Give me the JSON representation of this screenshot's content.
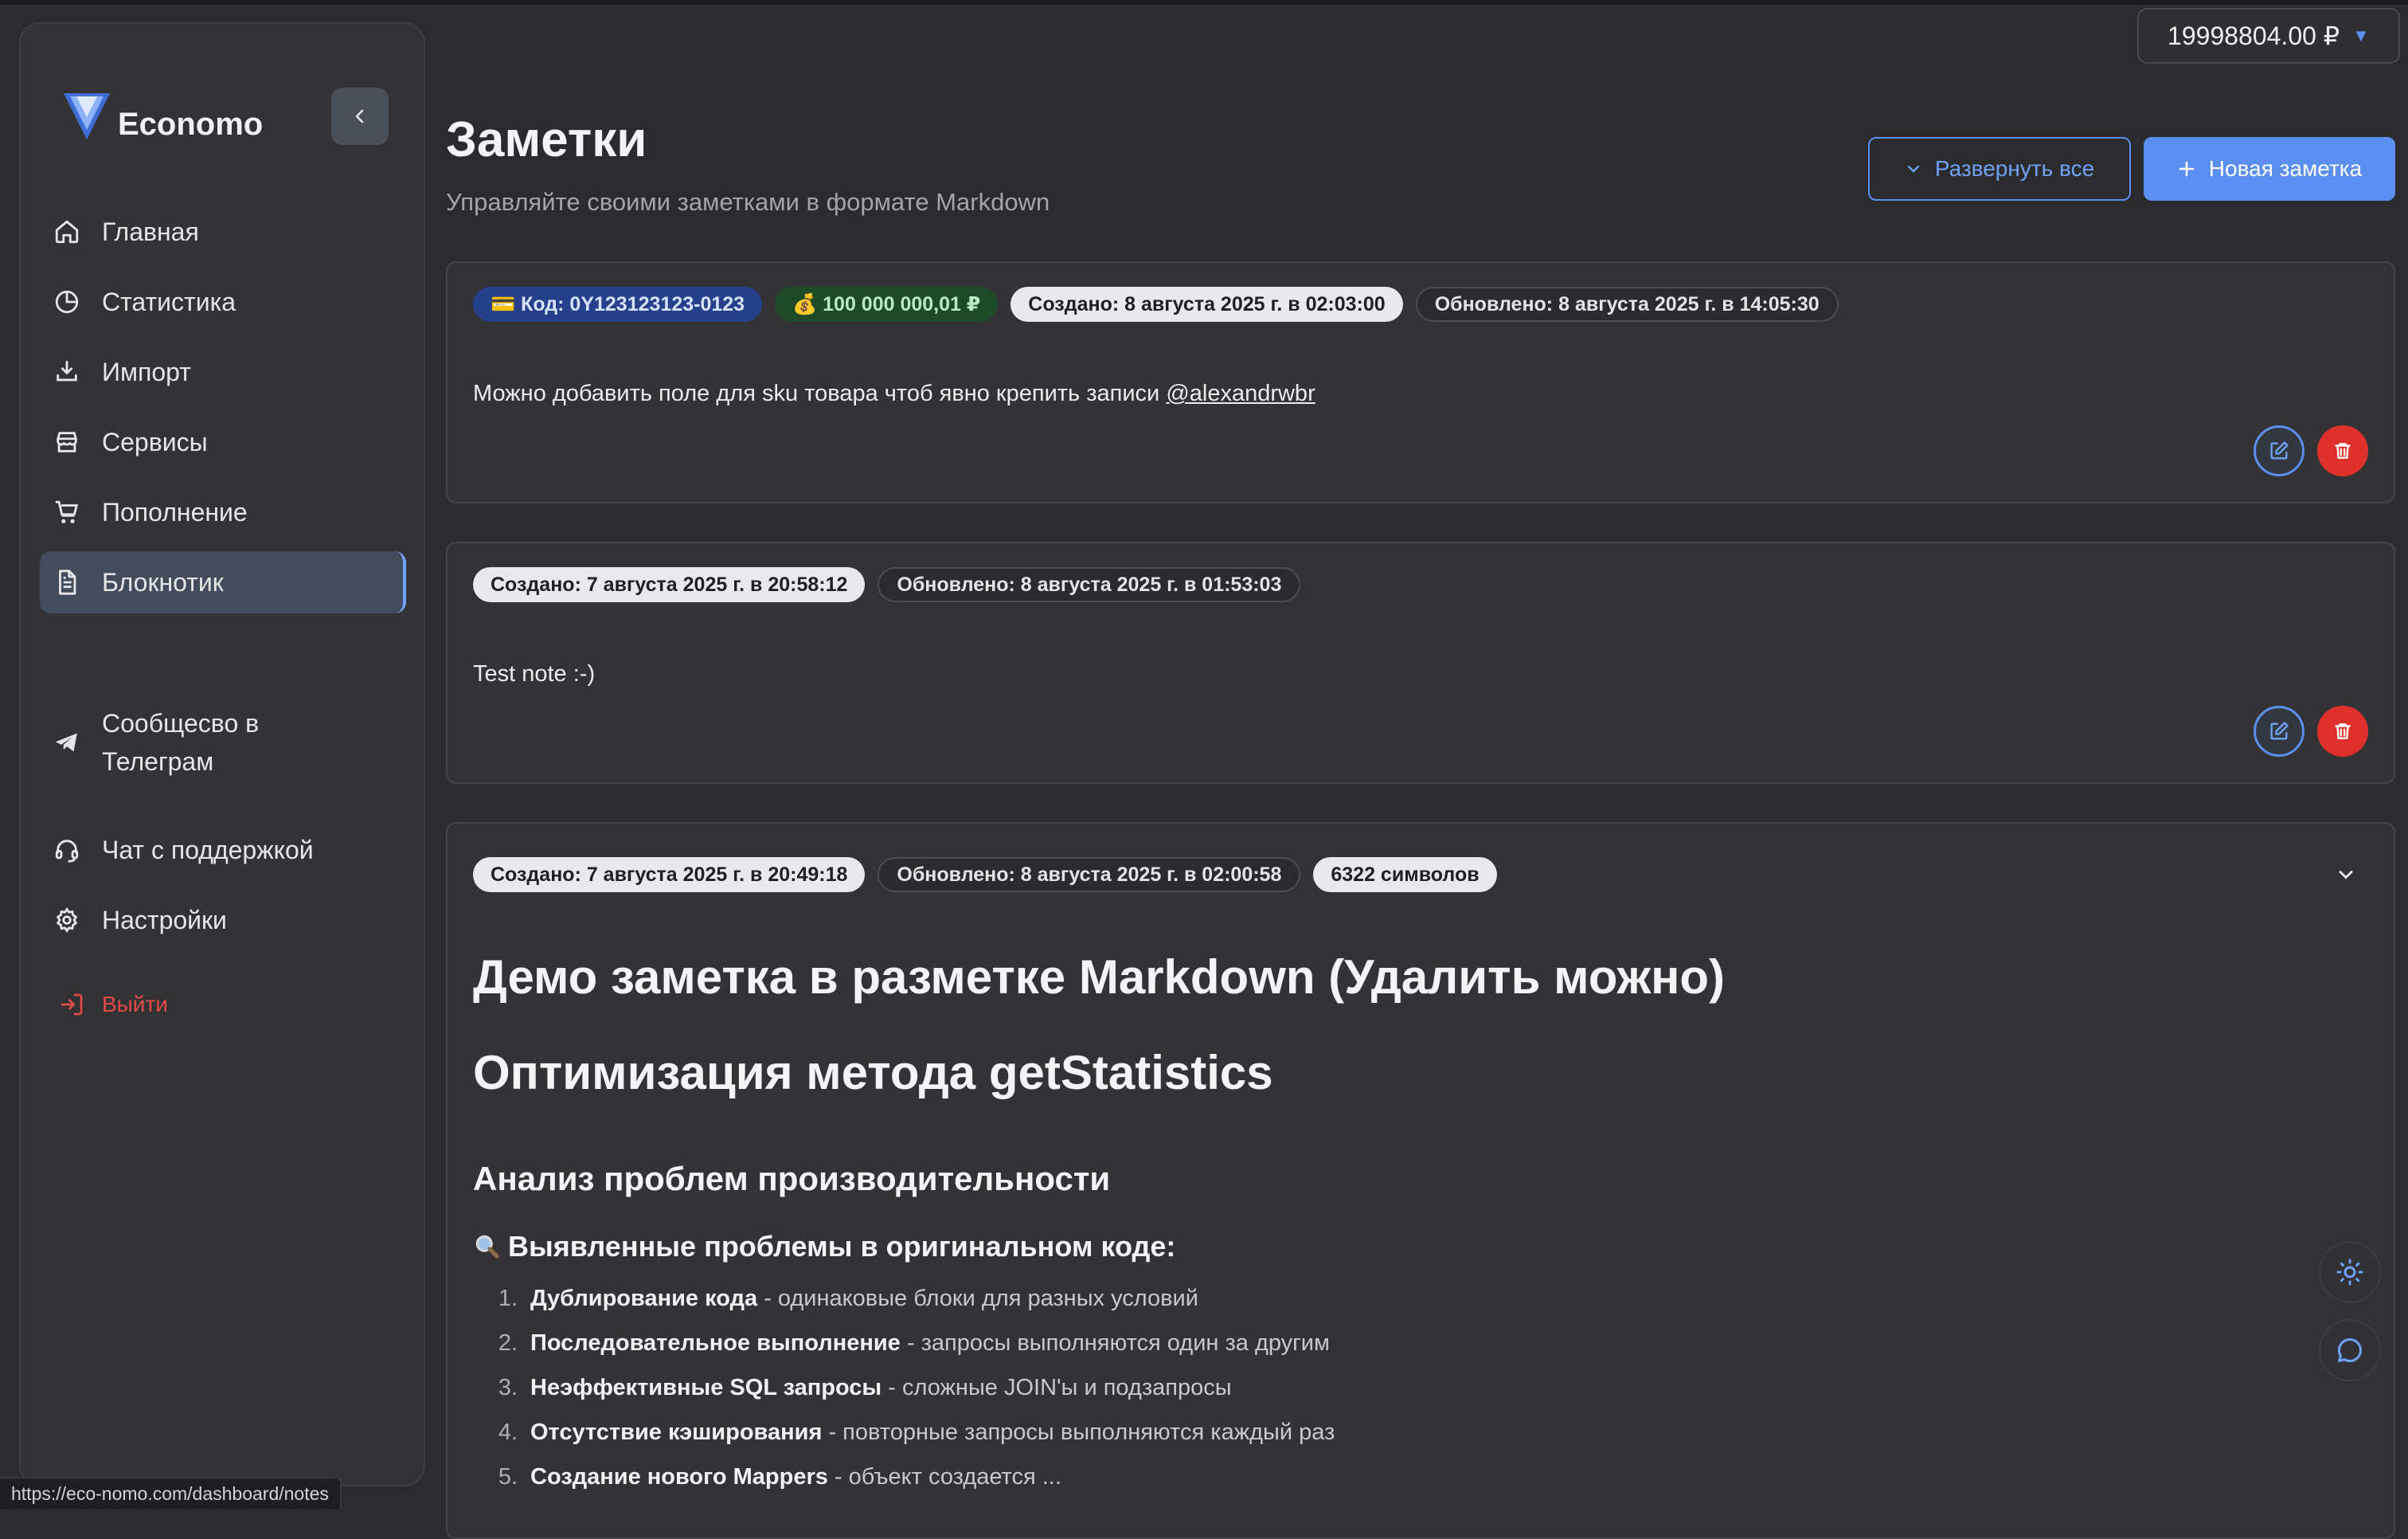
{
  "app": {
    "name": "Economo",
    "balance": "19998804.00 ₽"
  },
  "sidebar": {
    "items": [
      {
        "label": "Главная",
        "icon": "home-icon"
      },
      {
        "label": "Статистика",
        "icon": "chart-pie-icon"
      },
      {
        "label": "Импорт",
        "icon": "import-icon"
      },
      {
        "label": "Сервисы",
        "icon": "store-icon"
      },
      {
        "label": "Пополнение",
        "icon": "cart-icon"
      },
      {
        "label": "Блокнотик",
        "icon": "notebook-icon",
        "active": true
      }
    ],
    "secondary": [
      {
        "label": "Сообщесво в Телеграм",
        "icon": "telegram-icon"
      },
      {
        "label": "Чат с поддержкой",
        "icon": "headset-icon"
      },
      {
        "label": "Настройки",
        "icon": "gear-icon"
      }
    ],
    "logout": "Выйти"
  },
  "header": {
    "title": "Заметки",
    "subtitle": "Управляйте своими заметками в формате Markdown",
    "expand_all": "Развернуть все",
    "new_note": "Новая заметка"
  },
  "notes": [
    {
      "badges": {
        "code": "💳 Код: 0Y123123123-0123",
        "amount": "💰 100 000 000,01 ₽",
        "created": "Создано: 8 августа 2025 г. в 02:03:00",
        "updated": "Обновлено: 8 августа 2025 г. в 14:05:30"
      },
      "text": "Можно добавить поле для sku товара чтоб явно крепить записи ",
      "mention": "@alexandrwbr"
    },
    {
      "badges": {
        "created": "Создано: 7 августа 2025 г. в 20:58:12",
        "updated": "Обновлено: 8 августа 2025 г. в 01:53:03"
      },
      "text": "Test note :-)"
    },
    {
      "badges": {
        "created": "Создано: 7 августа 2025 г. в 20:49:18",
        "updated": "Обновлено: 8 августа 2025 г. в 02:00:58",
        "chars": "6322 символов"
      },
      "h1a": "Демо заметка в разметке Markdown (Удалить можно)",
      "h1b": "Оптимизация метода getStatistics",
      "h3": "Анализ проблем производительности",
      "h4": "Выявленные проблемы в оригинальном коде:",
      "list": [
        {
          "num": "1.",
          "bold": "Дублирование кода",
          "rest": " - одинаковые блоки для разных условий"
        },
        {
          "num": "2.",
          "bold": "Последовательное выполнение",
          "rest": " - запросы выполняются один за другим"
        },
        {
          "num": "3.",
          "bold": "Неэффективные SQL запросы",
          "rest": " - сложные JOIN'ы и подзапросы"
        },
        {
          "num": "4.",
          "bold": "Отсутствие кэширования",
          "rest": " - повторные запросы выполняются каждый раз"
        },
        {
          "num": "5.",
          "bold": "Создание нового Mappers",
          "rest": " - объект создается ..."
        }
      ]
    }
  ],
  "status_url": "https://eco-nomo.com/dashboard/notes",
  "colors": {
    "accent": "#5b8ff0",
    "danger": "#e0302c",
    "background": "#2b2b2d"
  }
}
